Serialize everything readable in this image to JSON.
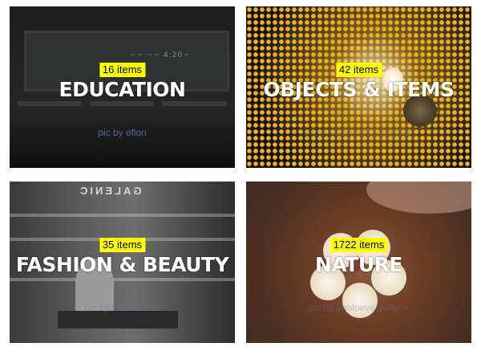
{
  "categories": [
    {
      "count": "16 items",
      "title": "EDUCATION",
      "credit": "pic by eflon"
    },
    {
      "count": "42 items",
      "title": "OBJECTS & ITEMS",
      "credit": "pic by lumaxart sebastian"
    },
    {
      "count": "35 items",
      "title": "FASHION & BEAUTY",
      "credit": "pic by mahnainda"
    },
    {
      "count": "1722 items",
      "title": "NATURE",
      "credit": "pic by photoeverywhere"
    }
  ],
  "colors": {
    "badge": "#ffff00",
    "credit": "#5577bb",
    "title": "#ffffff"
  }
}
